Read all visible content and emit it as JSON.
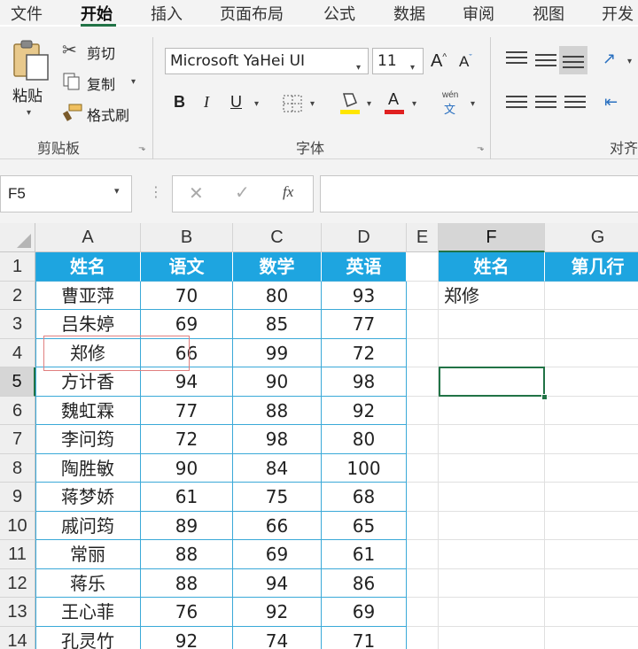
{
  "menu": {
    "tabs": [
      "文件",
      "开始",
      "插入",
      "页面布局",
      "公式",
      "数据",
      "审阅",
      "视图",
      "开发"
    ],
    "active_tab": "开始"
  },
  "ribbon": {
    "clipboard": {
      "paste": "粘贴",
      "cut": "剪切",
      "copy": "复制",
      "format_painter": "格式刷",
      "group_label": "剪贴板"
    },
    "font": {
      "font_name": "Microsoft YaHei UI",
      "font_size": "11",
      "grow": "A",
      "shrink": "A",
      "bold": "B",
      "italic": "I",
      "underline": "U",
      "font_color_glyph": "A",
      "phonetic_top": "wén",
      "phonetic_bottom": "文",
      "group_label": "字体",
      "highlight_color": "#ffe600",
      "font_color": "#e02020"
    },
    "alignment": {
      "group_label": "对齐"
    }
  },
  "formula_bar": {
    "name_box": "F5",
    "fx": "fx",
    "content": ""
  },
  "sheet": {
    "columns": [
      "A",
      "B",
      "C",
      "D",
      "E",
      "F",
      "G"
    ],
    "selected_column": "F",
    "selected_row": "5",
    "row_numbers": [
      "1",
      "2",
      "3",
      "4",
      "5",
      "6",
      "7",
      "8",
      "9",
      "10",
      "11",
      "12",
      "13",
      "14"
    ],
    "header_row": [
      "姓名",
      "语文",
      "数学",
      "英语"
    ],
    "rows": [
      [
        "曹亚萍",
        "70",
        "80",
        "93"
      ],
      [
        "吕朱婷",
        "69",
        "85",
        "77"
      ],
      [
        "郑修",
        "66",
        "99",
        "72"
      ],
      [
        "方计香",
        "94",
        "90",
        "98"
      ],
      [
        "魏虹霖",
        "77",
        "88",
        "92"
      ],
      [
        "李问筠",
        "72",
        "98",
        "80"
      ],
      [
        "陶胜敏",
        "90",
        "84",
        "100"
      ],
      [
        "蒋梦娇",
        "61",
        "75",
        "68"
      ],
      [
        "戚问筠",
        "89",
        "66",
        "65"
      ],
      [
        "常丽",
        "88",
        "69",
        "61"
      ],
      [
        "蒋乐",
        "88",
        "94",
        "86"
      ],
      [
        "王心菲",
        "76",
        "92",
        "69"
      ],
      [
        "孔灵竹",
        "92",
        "74",
        "71"
      ]
    ],
    "lookup_headers": [
      "姓名",
      "第几行"
    ],
    "lookup_value": "郑修",
    "table_header_color": "#1ea5e0",
    "table_border_color": "#3aa9d8",
    "selection_color": "#217346"
  }
}
